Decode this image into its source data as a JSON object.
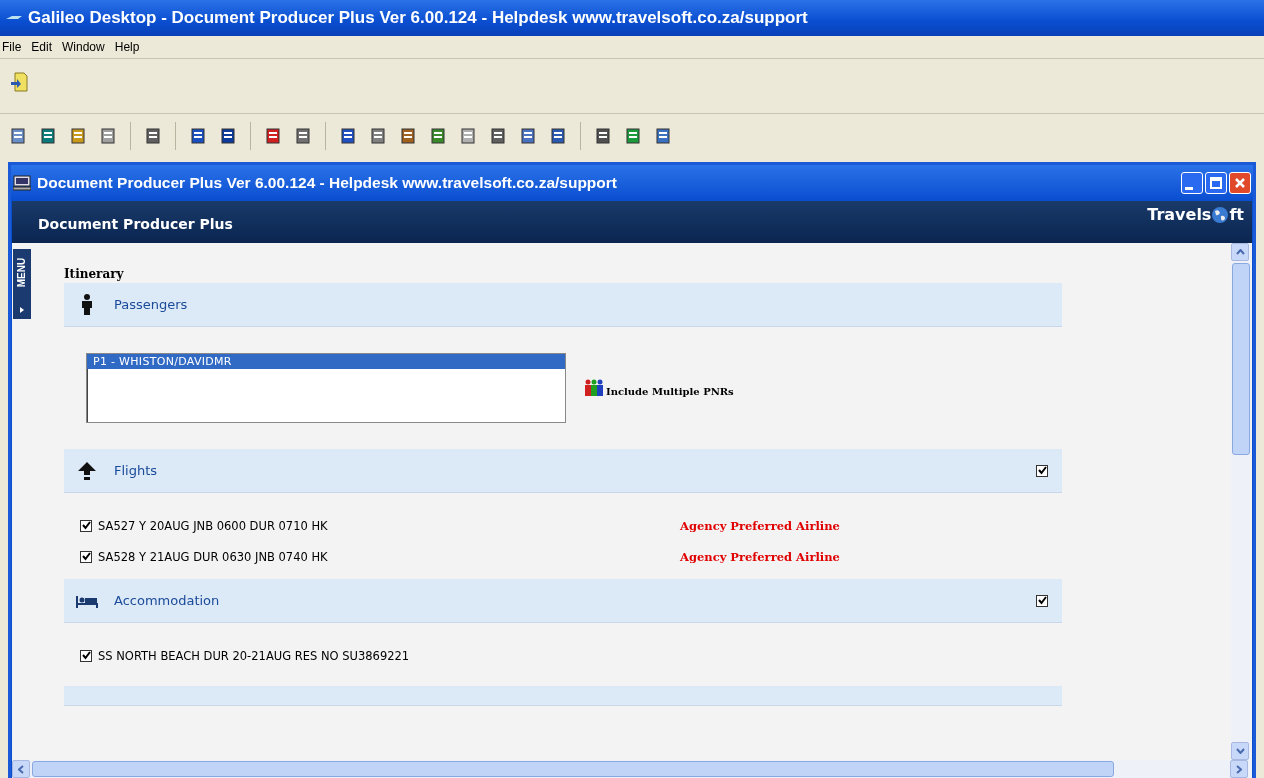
{
  "window": {
    "title": "Galileo Desktop - Document Producer Plus Ver 6.00.124 - Helpdesk www.travelsoft.co.za/support"
  },
  "menu": [
    "File",
    "Edit",
    "Window",
    "Help"
  ],
  "child_window": {
    "title": "Document Producer Plus Ver 6.00.124 - Helpdesk www.travelsoft.co.za/support",
    "header": "Document Producer Plus",
    "logo": {
      "before": "Travels",
      "after": "ft"
    },
    "side_tab": "MENU"
  },
  "itinerary": {
    "heading": "Itinerary",
    "sections": [
      {
        "kind": "passengers",
        "title": "Passengers",
        "passengers": [
          {
            "label": "P1 - WHISTON/DAVIDMR",
            "selected": true
          }
        ],
        "link": "Include Multiple PNRs"
      },
      {
        "kind": "flights",
        "title": "Flights",
        "checked": true,
        "items": [
          {
            "text": "SA527 Y 20AUG JNB 0600 DUR 0710 HK",
            "checked": true,
            "note": "Agency Preferred Airline"
          },
          {
            "text": "SA528 Y 21AUG DUR 0630 JNB 0740 HK",
            "checked": true,
            "note": "Agency Preferred Airline"
          }
        ]
      },
      {
        "kind": "accommodation",
        "title": "Accommodation",
        "checked": true,
        "items": [
          {
            "text": "SS NORTH BEACH DUR 20-21AUG RES NO SU3869221",
            "checked": true
          }
        ]
      }
    ]
  }
}
